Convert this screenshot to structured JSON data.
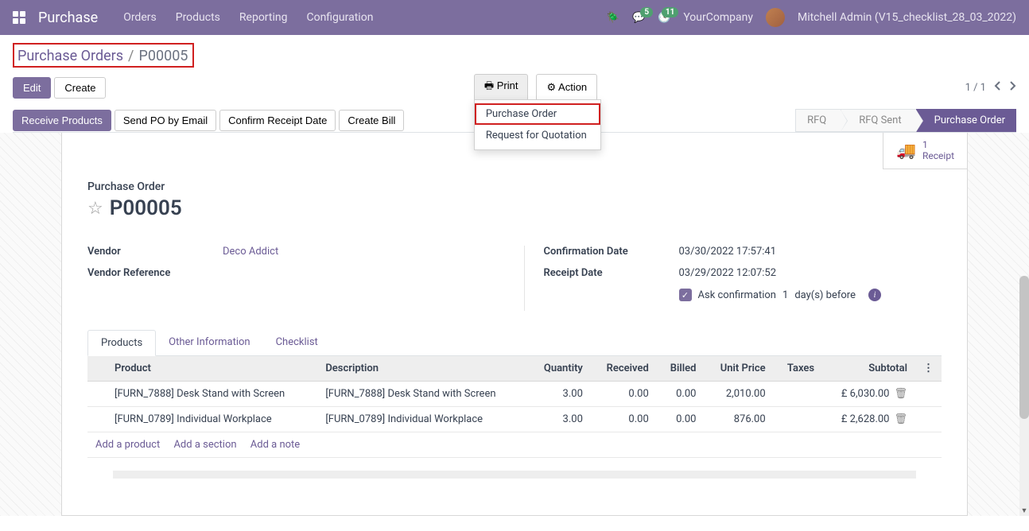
{
  "navbar": {
    "brand": "Purchase",
    "menu": [
      "Orders",
      "Products",
      "Reporting",
      "Configuration"
    ],
    "badge_messages": "5",
    "badge_activities": "11",
    "company": "YourCompany",
    "user": "Mitchell Admin (V15_checklist_28_03_2022)"
  },
  "breadcrumb": {
    "parent": "Purchase Orders",
    "current": "P00005"
  },
  "cp_buttons": {
    "edit": "Edit",
    "create": "Create",
    "print": "Print",
    "action": "Action",
    "pager": "1 / 1"
  },
  "print_menu": {
    "item1": "Purchase Order",
    "item2": "Request for Quotation"
  },
  "statusbar": {
    "receive_products": "Receive Products",
    "send_po": "Send PO by Email",
    "confirm_receipt": "Confirm Receipt Date",
    "create_bill": "Create Bill",
    "rfq": "RFQ",
    "rfq_sent": "RFQ Sent",
    "purchase_order": "Purchase Order"
  },
  "stat_button": {
    "count": "1",
    "label": "Receipt"
  },
  "doc": {
    "label": "Purchase Order",
    "name": "P00005"
  },
  "fields": {
    "vendor_label": "Vendor",
    "vendor_value": "Deco Addict",
    "vendor_ref_label": "Vendor Reference",
    "confirm_date_label": "Confirmation Date",
    "confirm_date_value": "03/30/2022 17:57:41",
    "receipt_date_label": "Receipt Date",
    "receipt_date_value": "03/29/2022 12:07:52",
    "ask_confirm_label": "Ask confirmation",
    "ask_confirm_days": "1",
    "ask_confirm_suffix": "day(s) before"
  },
  "tabs": {
    "products": "Products",
    "other_info": "Other Information",
    "checklist": "Checklist"
  },
  "table": {
    "headers": {
      "product": "Product",
      "description": "Description",
      "quantity": "Quantity",
      "received": "Received",
      "billed": "Billed",
      "unit_price": "Unit Price",
      "taxes": "Taxes",
      "subtotal": "Subtotal"
    },
    "rows": [
      {
        "product": "[FURN_7888] Desk Stand with Screen",
        "description": "[FURN_7888] Desk Stand with Screen",
        "quantity": "3.00",
        "received": "0.00",
        "billed": "0.00",
        "unit_price": "2,010.00",
        "taxes": "",
        "subtotal": "£ 6,030.00"
      },
      {
        "product": "[FURN_0789] Individual Workplace",
        "description": "[FURN_0789] Individual Workplace",
        "quantity": "3.00",
        "received": "0.00",
        "billed": "0.00",
        "unit_price": "876.00",
        "taxes": "",
        "subtotal": "£ 2,628.00"
      }
    ],
    "add_product": "Add a product",
    "add_section": "Add a section",
    "add_note": "Add a note"
  }
}
